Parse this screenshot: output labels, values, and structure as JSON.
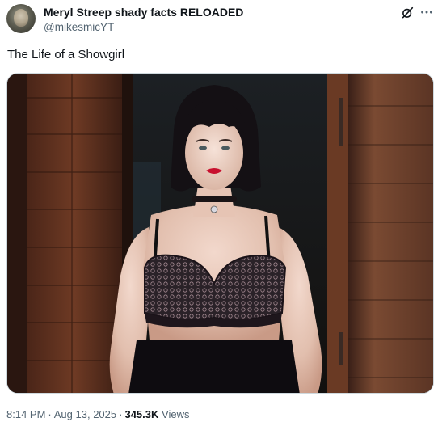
{
  "author": {
    "display_name": "Meryl Streep shady facts RELOADED",
    "handle": "@mikesmicYT"
  },
  "tweet": {
    "text": "The Life of a Showgirl",
    "time": "8:14 PM",
    "date": "Aug 13, 2025",
    "views_count": "345.3K",
    "views_label": "Views"
  },
  "icons": {
    "grok": "grok-icon",
    "more": "more-icon"
  },
  "colors": {
    "text": "#0f1419",
    "secondary": "#536471",
    "border": "#cfd9de"
  }
}
